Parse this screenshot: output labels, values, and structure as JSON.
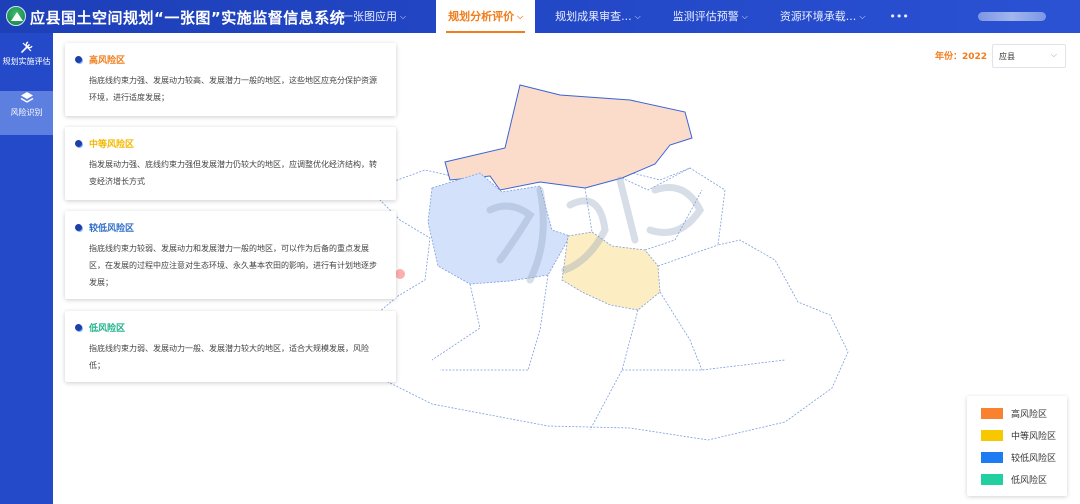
{
  "header": {
    "title": "应县国土空间规划“一张图”实施监督信息系统",
    "nav": [
      {
        "label": "一张图应用",
        "chevron": true,
        "active": false
      },
      {
        "label": "规划分析评价",
        "chevron": true,
        "active": true
      },
      {
        "label": "规划成果审查...",
        "chevron": true,
        "active": false
      },
      {
        "label": "监测评估预警",
        "chevron": true,
        "active": false
      },
      {
        "label": "资源环境承载...",
        "chevron": true,
        "active": false
      },
      {
        "label": "•••",
        "chevron": false,
        "active": false
      }
    ]
  },
  "sidebar": {
    "items": [
      {
        "label": "规划实施评估",
        "icon": "tools-icon",
        "active": false
      },
      {
        "label": "风险识别",
        "icon": "layers-icon",
        "active": true
      }
    ]
  },
  "cards": [
    {
      "title": "高风险区",
      "color": "#f07c1a",
      "text": "指底线约束力强、发展动力较高、发展潜力一般的地区，这些地区应充分保护资源环境，进行适度发展；"
    },
    {
      "title": "中等风险区",
      "color": "#f5b800",
      "text": "指发展动力强、底线约束力强但发展潜力仍较大的地区，应调整优化经济结构，转变经济增长方式"
    },
    {
      "title": "较低风险区",
      "color": "#2f6ec8",
      "text": "指底线约束力较弱、发展动力和发展潜力一般的地区，可以作为后备的重点发展区，在发展的过程中应注意对生态环境、永久基本农田的影响，进行有计划地逐步发展；"
    },
    {
      "title": "低风险区",
      "color": "#1fb38a",
      "text": "指底线约束力弱、发展动力一般、发展潜力较大的地区，适合大规模发展，风险低；"
    }
  ],
  "filter": {
    "year_label": "年份：2022",
    "region_value": "应县"
  },
  "legend": [
    {
      "label": "高风险区",
      "color": "#f98230"
    },
    {
      "label": "中等风险区",
      "color": "#f7c800"
    },
    {
      "label": "较低风险区",
      "color": "#1e7cf2"
    },
    {
      "label": "低风险区",
      "color": "#22cfa0"
    }
  ],
  "map_colors": {
    "high": "#fbdccb",
    "medium": "#fcedc2",
    "low": "#d3e1fa",
    "lowest": "#ffffff",
    "border": "#7a9ee0"
  }
}
